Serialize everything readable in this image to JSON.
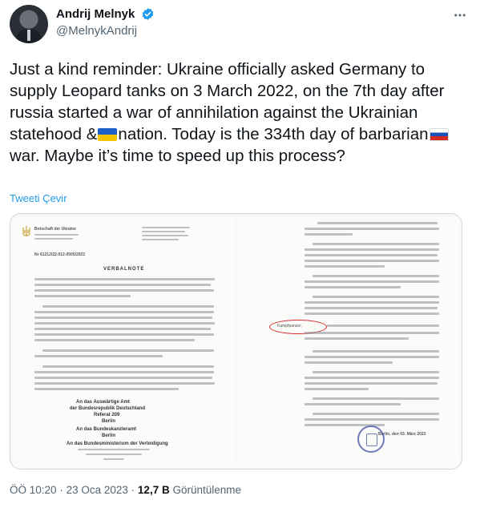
{
  "author": {
    "display_name": "Andrij Melnyk",
    "handle": "@MelnykAndrij",
    "verified_color": "#1d9bf0"
  },
  "tweet": {
    "text_part1": "Just a kind reminder: Ukraine officially asked Germany to supply Leopard tanks on 3 March 2022, on the 7th day after russia started a war of annihilation against the Ukrainian statehood &",
    "text_part2": "nation. Today is the 334th day of barbarian",
    "text_part3": "war. Maybe it’s time to speed up this process?",
    "translate_label": "Tweeti Çevir"
  },
  "document": {
    "left_header": "Botschaft der Ukraine",
    "ref_number": "Nr 61212/22-012-0505/2022",
    "title": "VERBALNOTE",
    "recipient_lines": [
      "An das Auswärtige Amt",
      "der Bundesrepublik Deutschland",
      "Referat 209",
      "Berlin"
    ],
    "recipient2": "An das Bundeskanzleramt",
    "recipient2_city": "Berlin",
    "recipient3": "An das Bundesministerium der Verteidigung",
    "right_date": "Berlin, den 03. März 2022",
    "circled_word": "Kampfpanzer,"
  },
  "meta": {
    "time": "ÖÖ 10:20",
    "separator": "·",
    "date": "23 Oca 2023",
    "views_count": "12,7 B",
    "views_label": "Görüntülenme"
  }
}
